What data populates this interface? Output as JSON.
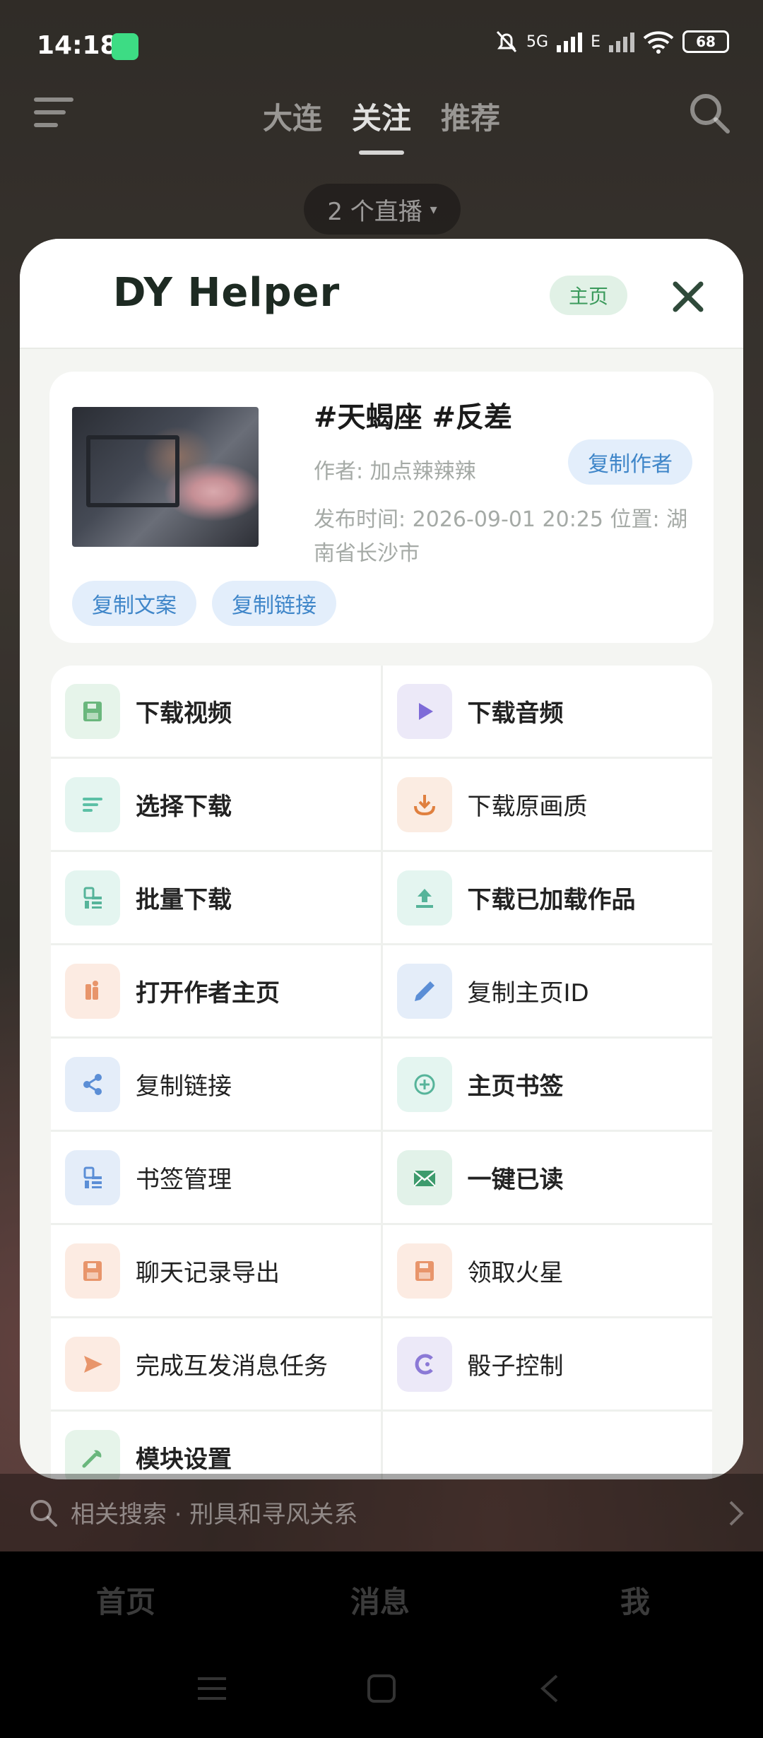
{
  "status_bar": {
    "time": "14:18",
    "network": "5G",
    "network2": "E",
    "battery": "68"
  },
  "top_nav": {
    "tabs": [
      "大连",
      "关注",
      "推荐"
    ],
    "active_tab": "关注",
    "live_pill": "2 个直播"
  },
  "dialog": {
    "title": "DY Helper",
    "badge": "主页",
    "video": {
      "title": "#天蝎座 #反差",
      "author": "作者: 加点辣辣辣",
      "copy_author": "复制作者",
      "time_location": "发布时间: 2026-09-01 20:25  位置: 湖南省长沙市",
      "copy_text": "复制文案",
      "copy_link": "复制链接"
    },
    "menu": [
      {
        "label": "下载视频",
        "icon": "save-icon",
        "color": "#6ab77d",
        "bg": "#e6f4ea",
        "bold": true
      },
      {
        "label": "下载音频",
        "icon": "play-icon",
        "color": "#7e6bd8",
        "bg": "#ece9f8",
        "bold": true
      },
      {
        "label": "选择下载",
        "icon": "list-icon",
        "color": "#5cc0a6",
        "bg": "#e4f5f0",
        "bold": true
      },
      {
        "label": "下载原画质",
        "icon": "download-icon",
        "color": "#e0803f",
        "bg": "#fbece2",
        "bold": false
      },
      {
        "label": "批量下载",
        "icon": "batch-icon",
        "color": "#56b49a",
        "bg": "#e4f5f0",
        "bold": true
      },
      {
        "label": "下载已加载作品",
        "icon": "upload-icon",
        "color": "#56b49a",
        "bg": "#e4f5f0",
        "bold": true
      },
      {
        "label": "打开作者主页",
        "icon": "person-icon",
        "color": "#e8956b",
        "bg": "#fcebe2",
        "bold": true
      },
      {
        "label": "复制主页ID",
        "icon": "pencil-icon",
        "color": "#5b8ed6",
        "bg": "#e4edf9",
        "bold": false
      },
      {
        "label": "复制链接",
        "icon": "share-icon",
        "color": "#5b8ed6",
        "bg": "#e4edf9",
        "bold": false
      },
      {
        "label": "主页书签",
        "icon": "plus-circle-icon",
        "color": "#56b49a",
        "bg": "#e4f5f0",
        "bold": true
      },
      {
        "label": "书签管理",
        "icon": "batch-icon",
        "color": "#5b8ed6",
        "bg": "#e4edf9",
        "bold": false
      },
      {
        "label": "一键已读",
        "icon": "mail-icon",
        "color": "#3d9b6d",
        "bg": "#e2f2e9",
        "bold": true
      },
      {
        "label": "聊天记录导出",
        "icon": "save-icon",
        "color": "#e8956b",
        "bg": "#fcebe2",
        "bold": false
      },
      {
        "label": "领取火星",
        "icon": "save-icon",
        "color": "#e8956b",
        "bg": "#fcebe2",
        "bold": false
      },
      {
        "label": "完成互发消息任务",
        "icon": "send-icon",
        "color": "#e8956b",
        "bg": "#fcebe2",
        "bold": false
      },
      {
        "label": "骰子控制",
        "icon": "dice-icon",
        "color": "#8b79d6",
        "bg": "#ece9f8",
        "bold": false
      },
      {
        "label": "模块设置",
        "icon": "wrench-icon",
        "color": "#6ab77d",
        "bg": "#e6f4ea",
        "bold": true
      }
    ]
  },
  "search_bar": {
    "text": "相关搜索 · 刑具和寻风关系"
  },
  "bottom_nav": {
    "items": [
      "首页",
      "消息",
      "我"
    ]
  }
}
